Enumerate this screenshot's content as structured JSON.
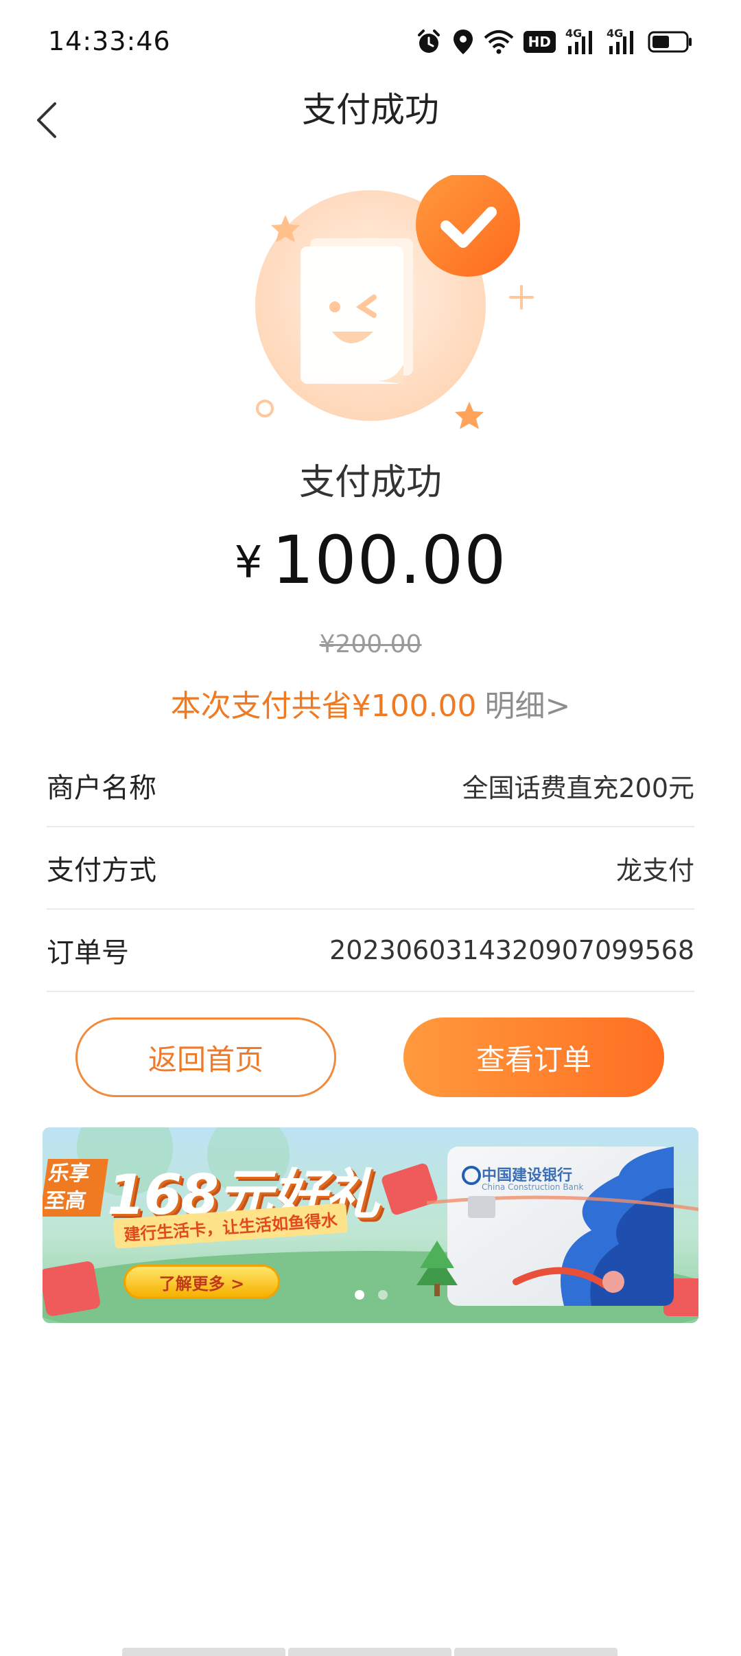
{
  "status_bar": {
    "time": "14:33:46",
    "icons": [
      "alarm-icon",
      "location-icon",
      "wifi-icon",
      "hd-icon",
      "signal-4g-icon",
      "signal-4g-icon",
      "battery-icon"
    ],
    "hd_label": "HD",
    "net_label": "4G"
  },
  "nav": {
    "title": "支付成功"
  },
  "result": {
    "title": "支付成功",
    "currency": "¥",
    "amount": "100.00",
    "original_price": "¥200.00",
    "saving_text": "本次支付共省¥100.00",
    "detail_link": "明细>"
  },
  "details": [
    {
      "label": "商户名称",
      "value": "全国话费直充200元"
    },
    {
      "label": "支付方式",
      "value": "龙支付"
    },
    {
      "label": "订单号",
      "value": "20230603143209070995​68"
    }
  ],
  "buttons": {
    "home": "返回首页",
    "order": "查看订单"
  },
  "banner": {
    "tag_line1": "乐享",
    "tag_line2": "至高",
    "headline": "168元好礼",
    "subline": "建行生活卡，让生活如鱼得水",
    "cta": "了解更多 >",
    "bank_name": "中国建设银行",
    "bank_name_en": "China Construction Bank",
    "active_dot": 0,
    "dot_count": 2
  },
  "colors": {
    "accent": "#f07a22",
    "button_start": "#ff9a3e",
    "button_end": "#ff6f23"
  }
}
